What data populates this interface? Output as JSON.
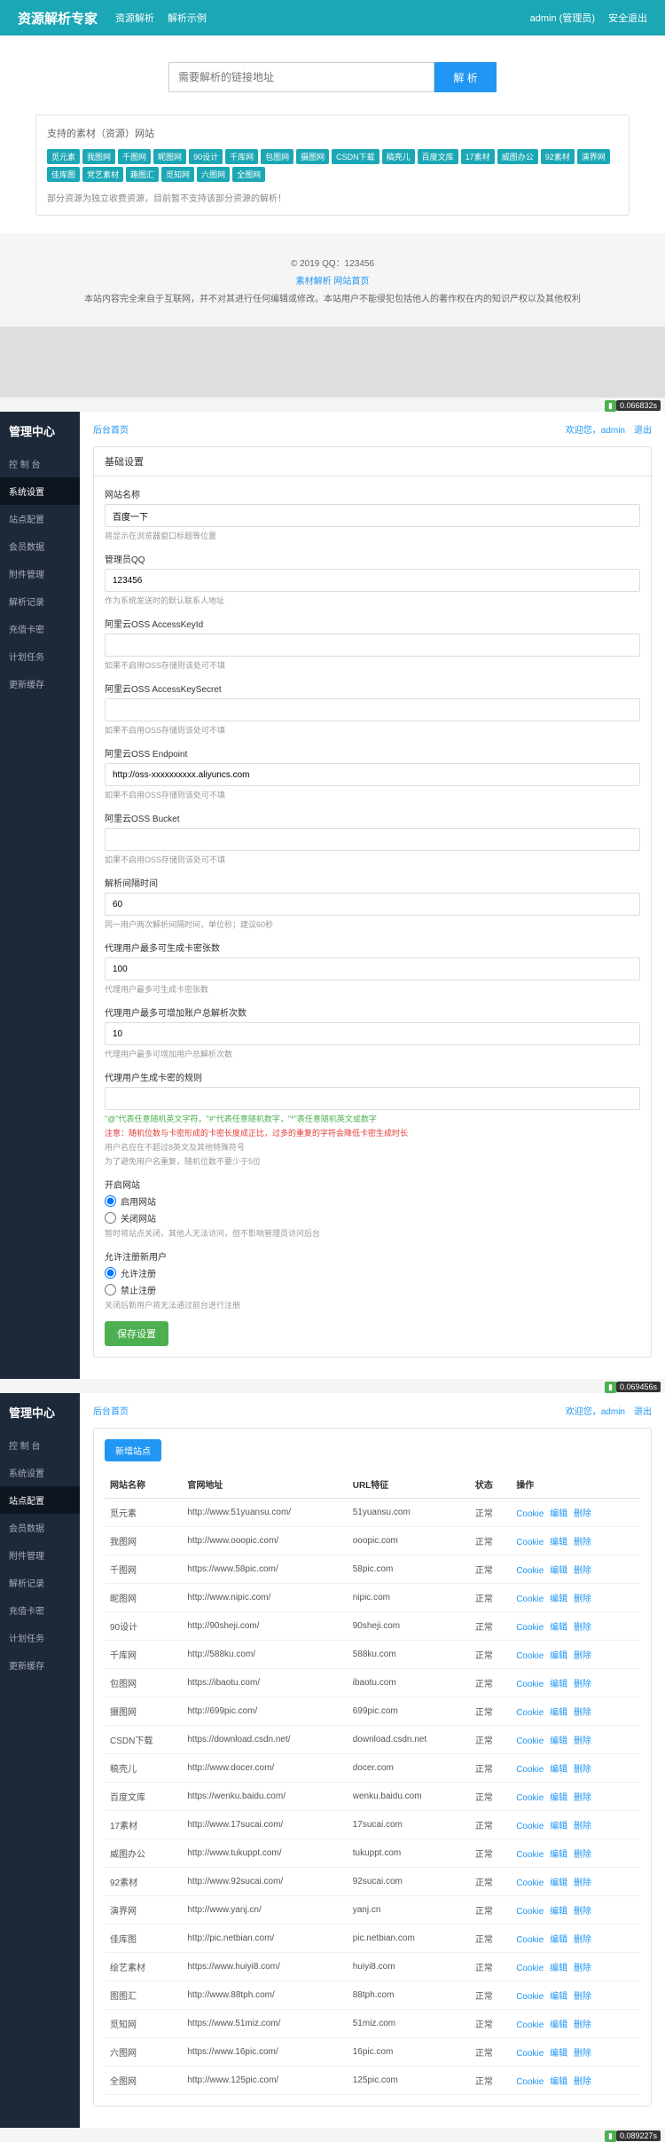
{
  "topbar": {
    "brand": "资源解析专家",
    "nav": [
      "资源解析",
      "解析示例"
    ],
    "user": "admin (管理员)",
    "logout": "安全退出"
  },
  "search": {
    "placeholder": "需要解析的链接地址",
    "button": "解 析"
  },
  "support": {
    "title": "支持的素材（资源）网站",
    "tags": [
      "觅元素",
      "我图网",
      "千图网",
      "昵图网",
      "90设计",
      "千库网",
      "包图网",
      "摄图网",
      "CSDN下载",
      "稿壳儿",
      "百度文库",
      "17素材",
      "威图办公",
      "92素材",
      "演界网",
      "佳库图",
      "党艺素材",
      "趣图汇",
      "觅知网",
      "六图网",
      "全图网"
    ],
    "note": "部分资源为独立收费资源，目前暂不支持该部分资源的解析！"
  },
  "footer": {
    "copyright": "© 2019 QQ：123456",
    "links": "素材解析 网站首页",
    "disclaimer": "本站内容完全来自于互联网，并不对其进行任何编辑或修改。本站用户不能侵犯包括他人的著作权在内的知识产权以及其他权利"
  },
  "timers": [
    "0.066832s",
    "0.069456s",
    "0.089227s"
  ],
  "admin": {
    "sidebar_title": "管理中心",
    "sidebar_items": [
      "控 制 台",
      "系统设置",
      "站点配置",
      "会员数据",
      "附件管理",
      "解析记录",
      "充值卡密",
      "计划任务",
      "更新缓存"
    ],
    "breadcrumb": "后台首页",
    "welcome": "欢迎您，admin",
    "logout": "退出"
  },
  "settings": {
    "card_title": "基础设置",
    "fields": {
      "site_name": {
        "label": "网站名称",
        "value": "百度一下",
        "hint": "将显示在浏览器窗口标题等位置"
      },
      "admin_qq": {
        "label": "管理员QQ",
        "value": "123456",
        "hint": "作为系统发送时的默认联系人地址"
      },
      "oss_key": {
        "label": "阿里云OSS AccessKeyId",
        "value": "",
        "hint": "如果不启用OSS存储则该处可不填"
      },
      "oss_secret": {
        "label": "阿里云OSS AccessKeySecret",
        "value": "",
        "hint": "如果不启用OSS存储则该处可不填"
      },
      "oss_endpoint": {
        "label": "阿里云OSS Endpoint",
        "value": "http://oss-xxxxxxxxxx.aliyuncs.com",
        "hint": "如果不启用OSS存储则该处可不填"
      },
      "oss_bucket": {
        "label": "阿里云OSS Bucket",
        "value": "",
        "hint": "如果不启用OSS存储则该处可不填"
      },
      "parse_interval": {
        "label": "解析间隔时间",
        "value": "60",
        "hint": "同一用户两次解析间隔时间，单位秒；建议60秒"
      },
      "max_cards": {
        "label": "代理用户最多可生成卡密张数",
        "value": "100",
        "hint": "代理用户最多可生成卡密张数"
      },
      "max_parse": {
        "label": "代理用户最多可增加账户总解析次数",
        "value": "10",
        "hint": "代理用户最多可增加用户总解析次数"
      },
      "card_rule": {
        "label": "代理用户生成卡密的规则",
        "value": "",
        "hint1": "\"@\"代表任意随机英文字符，\"#\"代表任意随机数字，\"*\"表任意随机英文或数字",
        "hint2": "注意：随机位数与卡密形成的卡密长度成正比，过多的重复的字符会降低卡密生成时长",
        "hint3": "用户名应在不超过8英文及其他特殊符号",
        "hint4": "为了避免用户名重复，随机位数不要少于5位"
      }
    },
    "site_toggle": {
      "label": "开启网站",
      "on": "启用网站",
      "off": "关闭网站",
      "hint": "暂时将站点关闭，其他人无法访问，但不影响管理员访问后台"
    },
    "reg_toggle": {
      "label": "允许注册新用户",
      "on": "允许注册",
      "off": "禁止注册",
      "hint": "关闭后新用户将无法通过前台进行注册"
    },
    "save_btn": "保存设置"
  },
  "sites": {
    "add_btn": "新增站点",
    "headers": [
      "网站名称",
      "官网地址",
      "URL特征",
      "状态",
      "操作"
    ],
    "rows": [
      {
        "name": "觅元素",
        "url": "http://www.51yuansu.com/",
        "feature": "51yuansu.com",
        "status": "正常"
      },
      {
        "name": "我图网",
        "url": "http://www.ooopic.com/",
        "feature": "ooopic.com",
        "status": "正常"
      },
      {
        "name": "千图网",
        "url": "https://www.58pic.com/",
        "feature": "58pic.com",
        "status": "正常"
      },
      {
        "name": "昵图网",
        "url": "http://www.nipic.com/",
        "feature": "nipic.com",
        "status": "正常"
      },
      {
        "name": "90设计",
        "url": "http://90sheji.com/",
        "feature": "90sheji.com",
        "status": "正常"
      },
      {
        "name": "千库网",
        "url": "http://588ku.com/",
        "feature": "588ku.com",
        "status": "正常"
      },
      {
        "name": "包图网",
        "url": "https://ibaotu.com/",
        "feature": "ibaotu.com",
        "status": "正常"
      },
      {
        "name": "摄图网",
        "url": "http://699pic.com/",
        "feature": "699pic.com",
        "status": "正常"
      },
      {
        "name": "CSDN下载",
        "url": "https://download.csdn.net/",
        "feature": "download.csdn.net",
        "status": "正常"
      },
      {
        "name": "稿壳儿",
        "url": "http://www.docer.com/",
        "feature": "docer.com",
        "status": "正常"
      },
      {
        "name": "百度文库",
        "url": "https://wenku.baidu.com/",
        "feature": "wenku.baidu.com",
        "status": "正常"
      },
      {
        "name": "17素材",
        "url": "http://www.17sucai.com/",
        "feature": "17sucai.com",
        "status": "正常"
      },
      {
        "name": "威图办公",
        "url": "http://www.tukuppt.com/",
        "feature": "tukuppt.com",
        "status": "正常"
      },
      {
        "name": "92素材",
        "url": "http://www.92sucai.com/",
        "feature": "92sucai.com",
        "status": "正常"
      },
      {
        "name": "演界网",
        "url": "http://www.yanj.cn/",
        "feature": "yanj.cn",
        "status": "正常"
      },
      {
        "name": "佳库图",
        "url": "http://pic.netbian.com/",
        "feature": "pic.netbian.com",
        "status": "正常"
      },
      {
        "name": "绘艺素材",
        "url": "https://www.huiyi8.com/",
        "feature": "huiyi8.com",
        "status": "正常"
      },
      {
        "name": "图图汇",
        "url": "http://www.88tph.com/",
        "feature": "88tph.com",
        "status": "正常"
      },
      {
        "name": "觅知网",
        "url": "https://www.51miz.com/",
        "feature": "51miz.com",
        "status": "正常"
      },
      {
        "name": "六图网",
        "url": "https://www.16pic.com/",
        "feature": "16pic.com",
        "status": "正常"
      },
      {
        "name": "全图网",
        "url": "http://www.125pic.com/",
        "feature": "125pic.com",
        "status": "正常"
      }
    ],
    "actions": [
      "Cookie",
      "编辑",
      "删除"
    ]
  }
}
